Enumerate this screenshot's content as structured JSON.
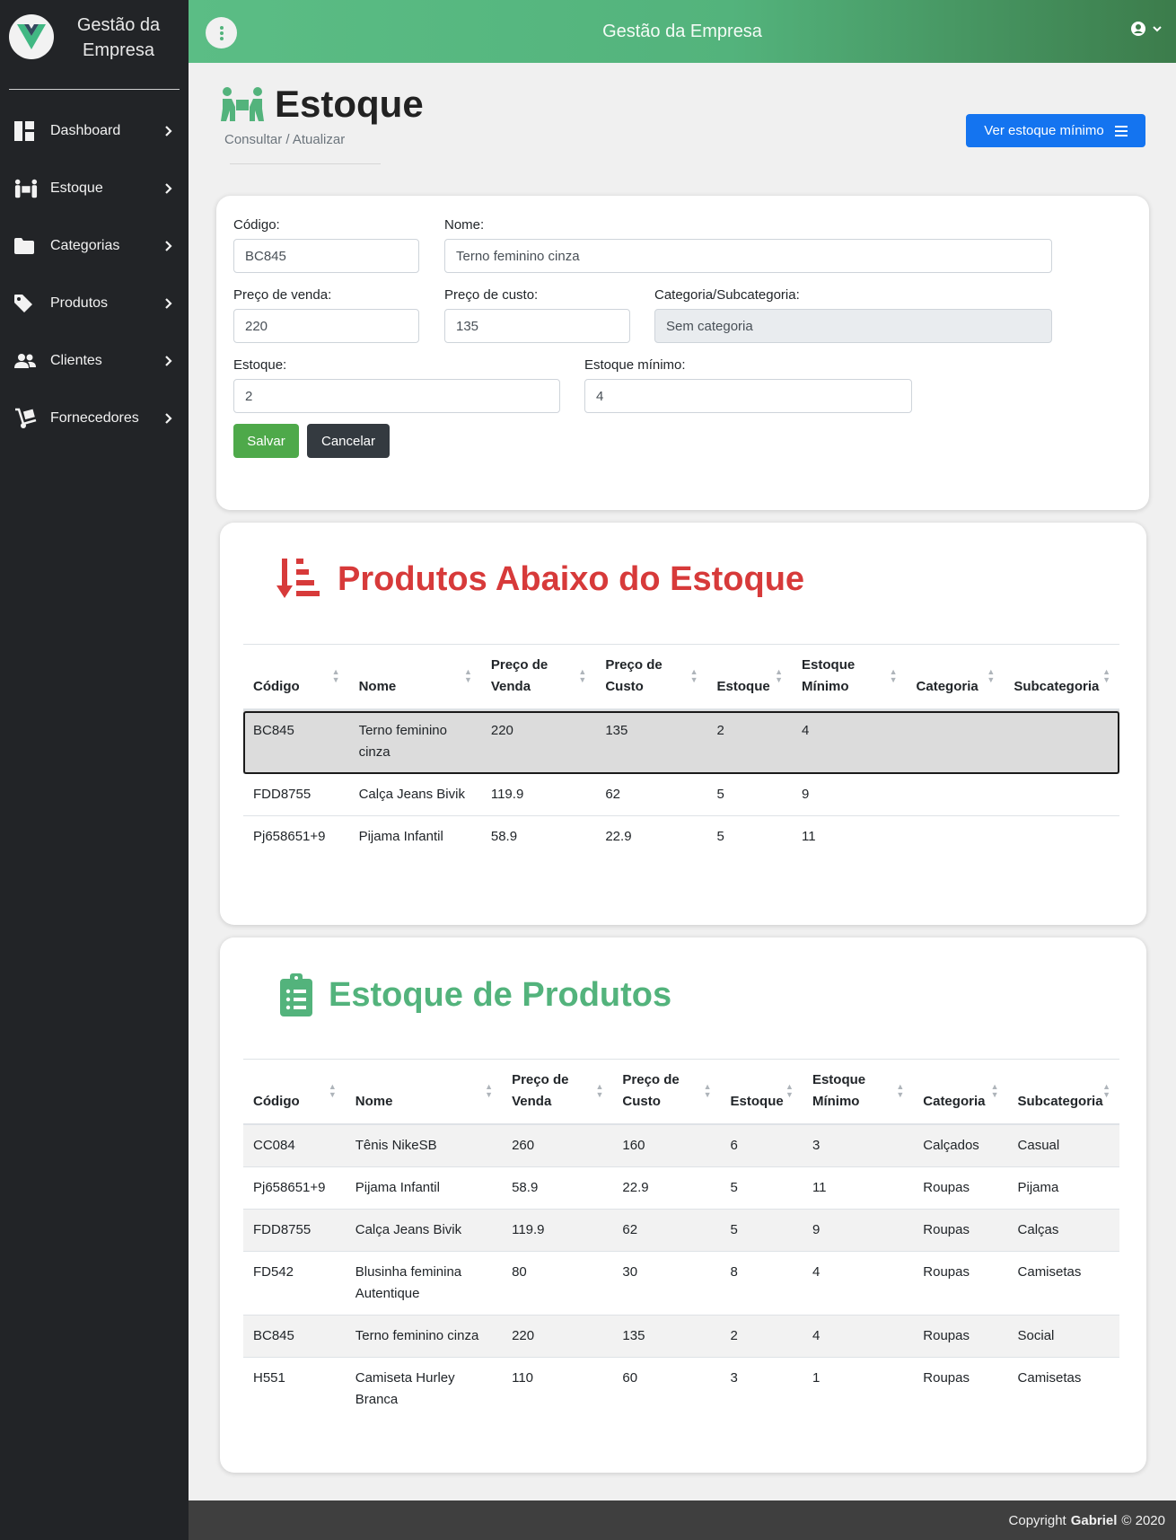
{
  "brand": {
    "title_line1": "Gestão da",
    "title_line2": "Empresa"
  },
  "sidebar": {
    "items": [
      {
        "label": "Dashboard",
        "icon": "dashboard-icon"
      },
      {
        "label": "Estoque",
        "icon": "people-carry-icon"
      },
      {
        "label": "Categorias",
        "icon": "folder-icon"
      },
      {
        "label": "Produtos",
        "icon": "tag-icon"
      },
      {
        "label": "Clientes",
        "icon": "users-icon"
      },
      {
        "label": "Fornecedores",
        "icon": "dolly-icon"
      }
    ]
  },
  "topbar": {
    "title": "Gestão da Empresa"
  },
  "page": {
    "title": "Estoque",
    "subtitle": "Consultar / Atualizar",
    "min_button": "Ver estoque mínimo"
  },
  "form": {
    "codigo_label": "Código:",
    "codigo_value": "BC845",
    "nome_label": "Nome:",
    "nome_value": "Terno feminino cinza",
    "preco_venda_label": "Preço de venda:",
    "preco_venda_value": "220",
    "preco_custo_label": "Preço de custo:",
    "preco_custo_value": "135",
    "categoria_label": "Categoria/Subcategoria:",
    "categoria_value": "Sem categoria",
    "estoque_label": "Estoque:",
    "estoque_value": "2",
    "estoque_min_label": "Estoque mínimo:",
    "estoque_min_value": "4",
    "save": "Salvar",
    "cancel": "Cancelar"
  },
  "low_stock": {
    "title": "Produtos Abaixo do Estoque",
    "headers": [
      "Código",
      "Nome",
      "Preço de Venda",
      "Preço de Custo",
      "Estoque",
      "Estoque Mínimo",
      "Categoria",
      "Subcategoria"
    ],
    "rows": [
      [
        "BC845",
        "Terno feminino cinza",
        "220",
        "135",
        "2",
        "4",
        "",
        ""
      ],
      [
        "FDD8755",
        "Calça Jeans Bivik",
        "119.9",
        "62",
        "5",
        "9",
        "",
        ""
      ],
      [
        "Pj658651+9",
        "Pijama Infantil",
        "58.9",
        "22.9",
        "5",
        "11",
        "",
        ""
      ]
    ]
  },
  "stock": {
    "title": "Estoque de Produtos",
    "headers": [
      "Código",
      "Nome",
      "Preço de Venda",
      "Preço de Custo",
      "Estoque",
      "Estoque Mínimo",
      "Categoria",
      "Subcategoria"
    ],
    "rows": [
      [
        "CC084",
        "Tênis NikeSB",
        "260",
        "160",
        "6",
        "3",
        "Calçados",
        "Casual"
      ],
      [
        "Pj658651+9",
        "Pijama Infantil",
        "58.9",
        "22.9",
        "5",
        "11",
        "Roupas",
        "Pijama"
      ],
      [
        "FDD8755",
        "Calça Jeans Bivik",
        "119.9",
        "62",
        "5",
        "9",
        "Roupas",
        "Calças"
      ],
      [
        "FD542",
        "Blusinha feminina Autentique",
        "80",
        "30",
        "8",
        "4",
        "Roupas",
        "Camisetas"
      ],
      [
        "BC845",
        "Terno feminino cinza",
        "220",
        "135",
        "2",
        "4",
        "Roupas",
        "Social"
      ],
      [
        "H551",
        "Camiseta Hurley Branca",
        "110",
        "60",
        "3",
        "1",
        "Roupas",
        "Camisetas"
      ]
    ]
  },
  "footer": {
    "prefix": "Copyright",
    "author": "Gabriel",
    "suffix": "© 2020"
  },
  "colors": {
    "green": "#53b37c",
    "danger": "#d73a3a",
    "primary": "#1474f0",
    "sidebar": "#222427"
  }
}
